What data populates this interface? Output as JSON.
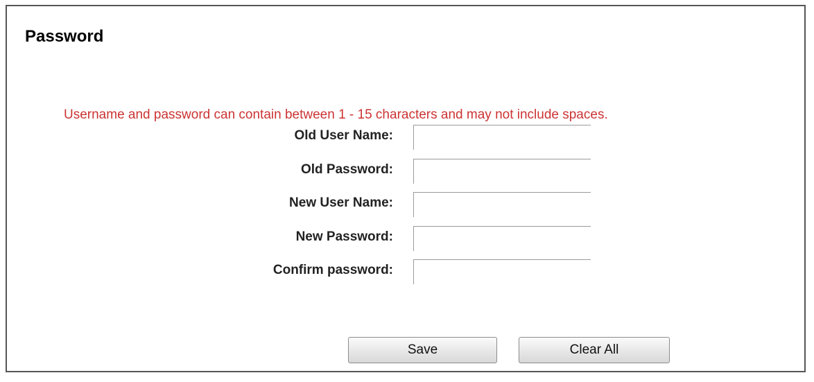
{
  "page": {
    "title": "Password",
    "notice": "Username and password can contain between 1 - 15 characters and may not include spaces."
  },
  "form": {
    "fields": [
      {
        "label": "Old User Name:",
        "value": ""
      },
      {
        "label": "Old Password:",
        "value": ""
      },
      {
        "label": "New User Name:",
        "value": ""
      },
      {
        "label": "New Password:",
        "value": ""
      },
      {
        "label": "Confirm password:",
        "value": ""
      }
    ]
  },
  "buttons": {
    "save_label": "Save",
    "clear_label": "Clear All"
  },
  "colors": {
    "notice": "#cc3333",
    "border": "#555555"
  }
}
